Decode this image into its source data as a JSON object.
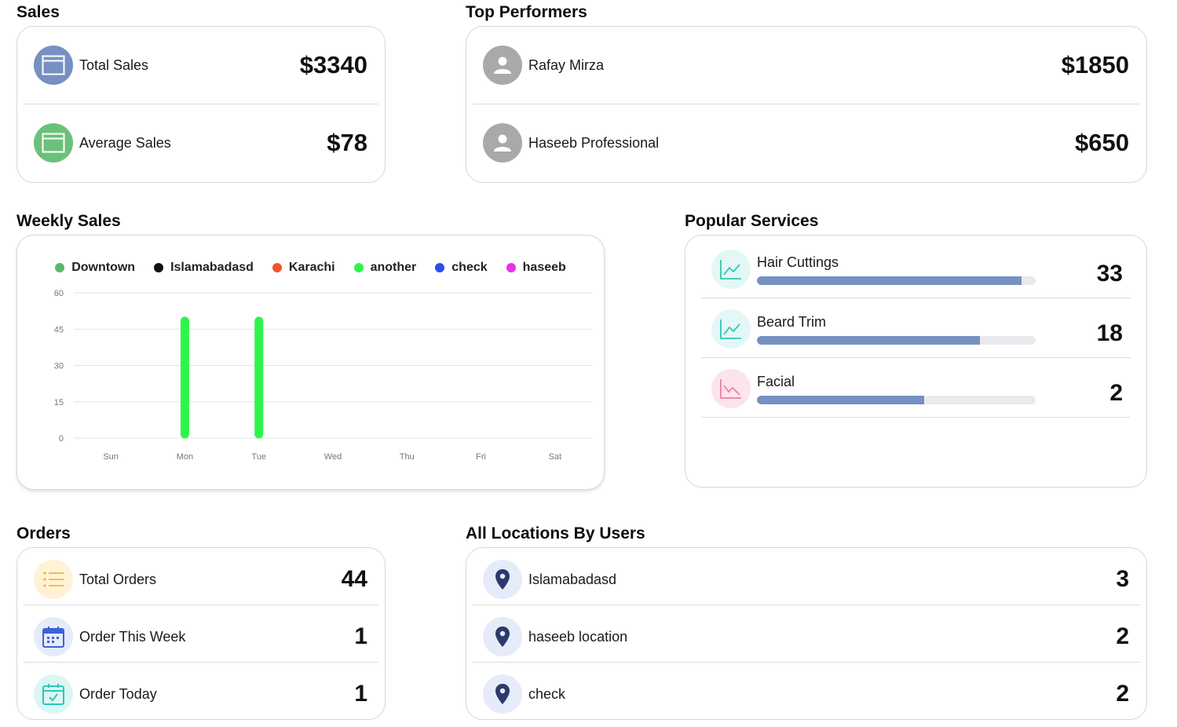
{
  "sales": {
    "title": "Sales",
    "items": [
      {
        "label": "Total Sales",
        "value": "$3340",
        "icon": "window-icon",
        "color": "#7690c2"
      },
      {
        "label": "Average Sales",
        "value": "$78",
        "icon": "window-icon",
        "color": "#6cc17a"
      }
    ]
  },
  "top_performers": {
    "title": "Top Performers",
    "items": [
      {
        "name": "Rafay Mirza",
        "value": "$1850",
        "icon": "person-icon"
      },
      {
        "name": "Haseeb Professional",
        "value": "$650",
        "icon": "person-icon"
      }
    ]
  },
  "weekly_sales": {
    "title": "Weekly Sales"
  },
  "chart_data": {
    "type": "bar",
    "categories": [
      "Sun",
      "Mon",
      "Tue",
      "Wed",
      "Thu",
      "Fri",
      "Sat"
    ],
    "yticks": [
      "0",
      "15",
      "30",
      "45",
      "60"
    ],
    "ylim": [
      0,
      60
    ],
    "grid": true,
    "legend_position": "top",
    "series": [
      {
        "name": "Downtown",
        "color": "#5bb96a",
        "values": [
          0,
          0,
          0,
          0,
          0,
          0,
          0
        ]
      },
      {
        "name": "Islamabadasd",
        "color": "#111111",
        "values": [
          0,
          0,
          0,
          0,
          0,
          0,
          0
        ]
      },
      {
        "name": "Karachi",
        "color": "#f0552a",
        "values": [
          0,
          0,
          0,
          0,
          0,
          0,
          0
        ]
      },
      {
        "name": "another",
        "color": "#2df54a",
        "values": [
          0,
          50,
          50,
          0,
          0,
          0,
          0
        ]
      },
      {
        "name": "check",
        "color": "#2b4ef0",
        "values": [
          0,
          0,
          0,
          0,
          0,
          0,
          0
        ]
      },
      {
        "name": "haseeb",
        "color": "#e632e6",
        "values": [
          0,
          0,
          0,
          0,
          0,
          0,
          0
        ]
      }
    ]
  },
  "popular_services": {
    "title": "Popular Services",
    "items": [
      {
        "name": "Hair Cuttings",
        "count": "33",
        "progress": 0.95,
        "icon": "trend-up-icon",
        "icon_color": "#2fc7b7",
        "bg": "#e3f8f6"
      },
      {
        "name": "Beard Trim",
        "count": "18",
        "progress": 0.8,
        "icon": "trend-up-icon",
        "icon_color": "#2fc7b7",
        "bg": "#e3f8f6"
      },
      {
        "name": "Facial",
        "count": "2",
        "progress": 0.6,
        "icon": "trend-down-icon",
        "icon_color": "#ef7fa8",
        "bg": "#fde3ec"
      }
    ]
  },
  "orders": {
    "title": "Orders",
    "items": [
      {
        "label": "Total Orders",
        "value": "44",
        "icon": "list-icon"
      },
      {
        "label": "Order This Week",
        "value": "1",
        "icon": "calendar-icon"
      },
      {
        "label": "Order Today",
        "value": "1",
        "icon": "calendar-check-icon"
      }
    ]
  },
  "locations": {
    "title": "All Locations By Users",
    "items": [
      {
        "name": "Islamabadasd",
        "count": "3",
        "icon": "location-pin-icon"
      },
      {
        "name": "haseeb location",
        "count": "2",
        "icon": "location-pin-icon"
      },
      {
        "name": "check",
        "count": "2",
        "icon": "location-pin-icon"
      }
    ]
  }
}
